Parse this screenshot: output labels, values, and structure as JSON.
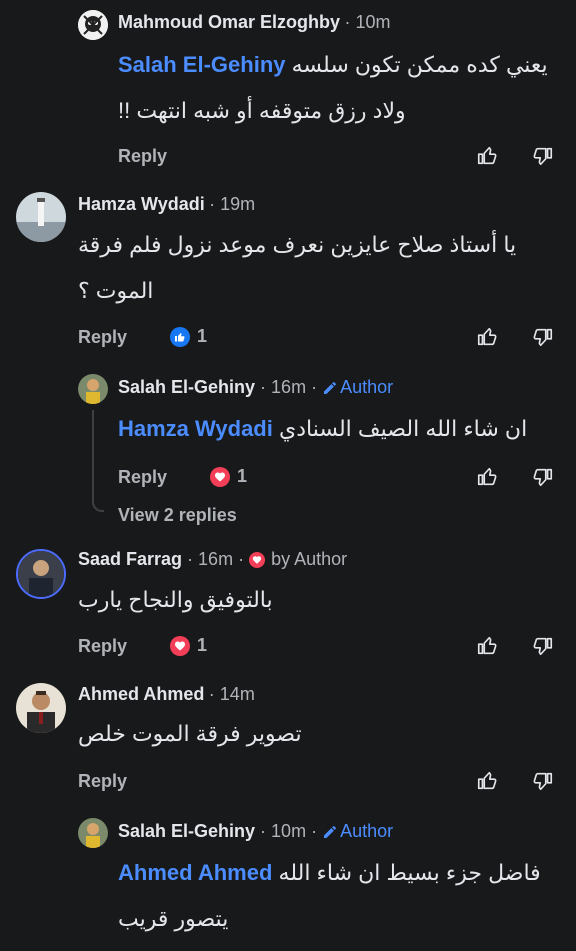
{
  "comments": [
    {
      "name": "Mahmoud Omar Elzoghby",
      "time": "10m",
      "mention": "Salah El-Gehiny",
      "line1": "يعني كده ممكن تكون سلسه",
      "line2": "ولاد رزق متوقفه أو شبه انتهت !!",
      "reply": "Reply"
    },
    {
      "name": "Hamza Wydadi",
      "time": "19m",
      "line1": "يا أستاذ صلاح عايزين نعرف موعد نزول فلم فرقة",
      "line2": "الموت ؟",
      "reply": "Reply",
      "reaction_count": "1"
    },
    {
      "name": "Salah El-Gehiny",
      "time": "16m",
      "author": "Author",
      "mention": "Hamza Wydadi",
      "line1": "ان شاء الله الصيف السنادي",
      "reply": "Reply",
      "reaction_count": "1",
      "view_replies": "View 2 replies"
    },
    {
      "name": "Saad Farrag",
      "time": "16m",
      "by_author": "by Author",
      "line1": "بالتوفيق والنجاح يارب",
      "reply": "Reply",
      "reaction_count": "1"
    },
    {
      "name": "Ahmed Ahmed",
      "time": "14m",
      "line1": "تصوير فرقة الموت خلص",
      "reply": "Reply"
    },
    {
      "name": "Salah El-Gehiny",
      "time": "10m",
      "author": "Author",
      "mention": "Ahmed Ahmed",
      "line1": "فاضل جزء بسيط ان شاء الله",
      "line2": "يتصور قريب"
    }
  ],
  "colors": {
    "background": "#18191a",
    "mention": "#4b8cff",
    "like": "#1877f2",
    "love": "#f33e58",
    "secondary": "#b0b3b8"
  }
}
